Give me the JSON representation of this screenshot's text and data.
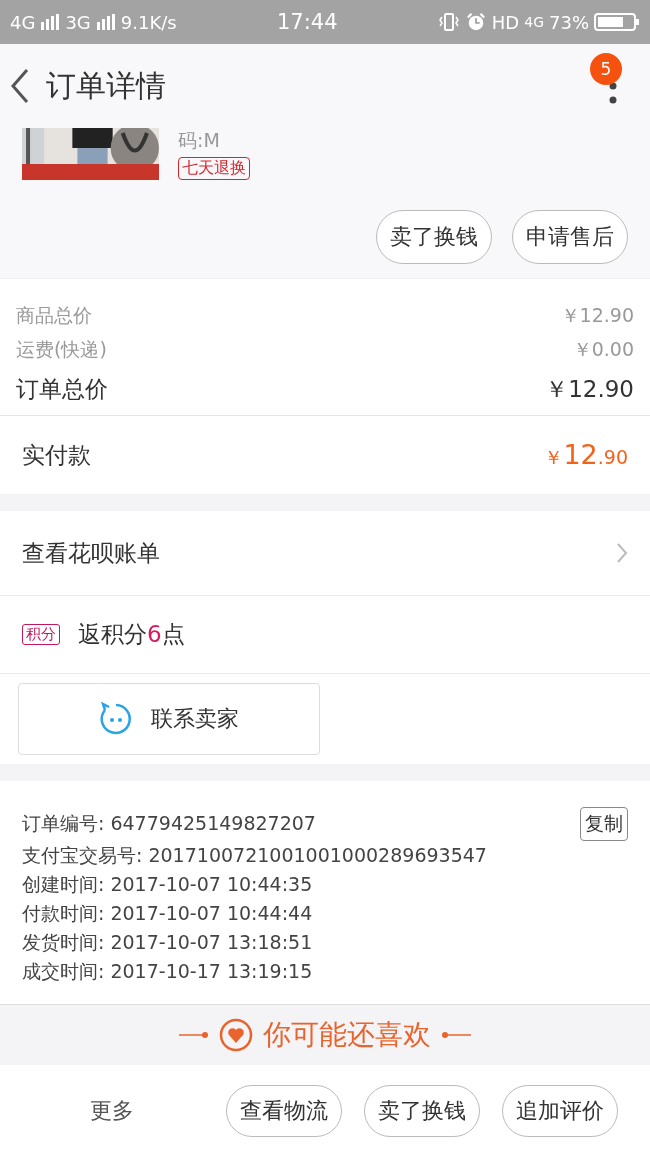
{
  "status_bar": {
    "network_1": "4G",
    "network_2": "3G",
    "speed": "9.1K/s",
    "time": "17:44",
    "hd": "HD",
    "network_3": "4G",
    "battery": "73%"
  },
  "nav": {
    "title": "订单详情",
    "badge": "5"
  },
  "product": {
    "spec": "码:M",
    "tag": "七天退换"
  },
  "actions": [
    "卖了换钱",
    "申请售后"
  ],
  "prices": [
    {
      "label": "商品总价",
      "value": "￥12.90",
      "kind": "minor"
    },
    {
      "label": "运费(快递)",
      "value": "￥0.00",
      "kind": "minor"
    },
    {
      "label": "订单总价",
      "value": "￥12.90",
      "kind": "total"
    }
  ],
  "paid": {
    "label": "实付款",
    "symbol": "￥",
    "integer": "12",
    "decimal": ".90"
  },
  "huabei": {
    "label": "查看花呗账单"
  },
  "points": {
    "tag": "积分",
    "prefix": "返积分",
    "number": "6",
    "suffix": "点"
  },
  "contact_button": "联系卖家",
  "order_info": {
    "copy_button": "复制",
    "rows": [
      {
        "label": "订单编号:",
        "value": "64779425149827207"
      },
      {
        "label": "支付宝交易号:",
        "value": "2017100721001001000289693547"
      },
      {
        "label": "创建时间:",
        "value": "2017-10-07 10:44:35"
      },
      {
        "label": "付款时间:",
        "value": "2017-10-07 10:44:44"
      },
      {
        "label": "发货时间:",
        "value": "2017-10-07 13:18:51"
      },
      {
        "label": "成交时间:",
        "value": "2017-10-17 13:19:15"
      }
    ]
  },
  "recommend": {
    "title": "你可能还喜欢"
  },
  "bottom_bar": {
    "more": "更多",
    "buttons": [
      "查看物流",
      "卖了换钱",
      "追加评价"
    ]
  }
}
